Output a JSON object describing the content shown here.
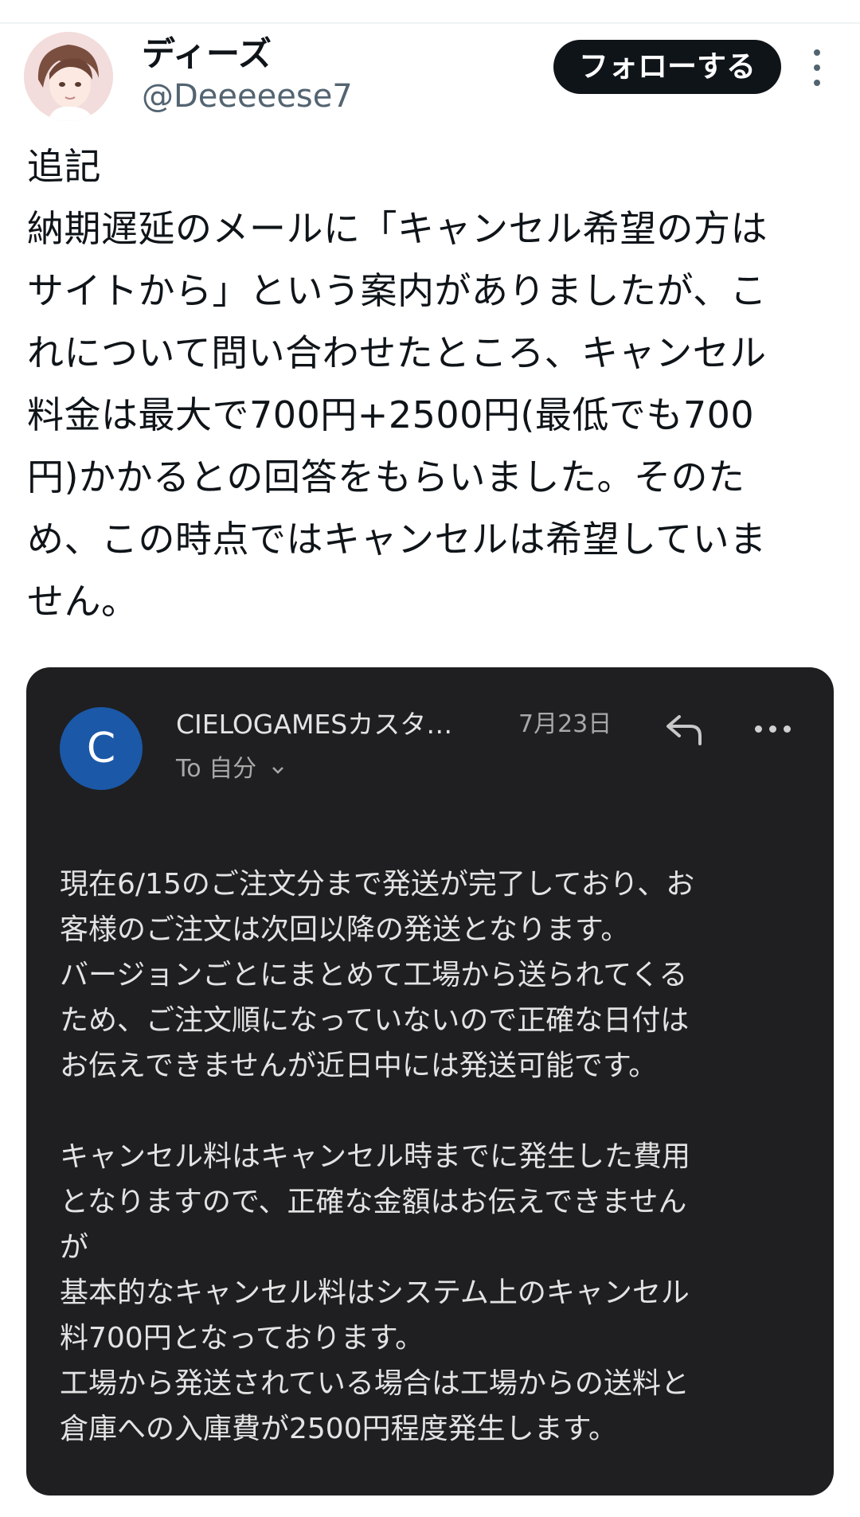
{
  "author": {
    "display_name": "ディーズ",
    "handle": "@Deeeeese7"
  },
  "actions": {
    "follow_label": "フォローする"
  },
  "icons": {
    "more": "more-vertical-icon",
    "reply": "reply-icon",
    "email_more": "more-horizontal-icon",
    "dropdown": "chevron-down-icon"
  },
  "tweet": {
    "lines": [
      "追記",
      "納期遅延のメールに「キャンセル希望の方は",
      "サイトから」という案内がありましたが、こ",
      "れについて問い合わせたところ、キャンセル",
      "料金は最大で700円+2500円(最低でも700",
      "円)かかるとの回答をもらいました。そのた",
      "め、この時点ではキャンセルは希望していま",
      "せん。"
    ]
  },
  "email": {
    "sender_initial": "C",
    "sender": "CIELOGAMESカスタ…",
    "date": "7月23日",
    "recipient": "To 自分",
    "paragraph1": [
      "現在6/15のご注文分まで発送が完了しており、お",
      "客様のご注文は次回以降の発送となります。",
      "バージョンごとにまとめて工場から送られてくる",
      "ため、ご注文順になっていないので正確な日付は",
      "お伝えできませんが近日中には発送可能です。"
    ],
    "paragraph2": [
      "キャンセル料はキャンセル時までに発生した費用",
      "となりますので、正確な金額はお伝えできません",
      "が",
      "基本的なキャンセル料はシステム上のキャンセル",
      "料700円となっております。",
      "工場から発送されている場合は工場からの送料と",
      "倉庫への入庫費が2500円程度発生します。"
    ]
  },
  "colors": {
    "follow_button_bg": "#0f1419",
    "card_bg": "#1f1f21",
    "sender_avatar_bg": "#1b58a8",
    "secondary_text": "#536471"
  }
}
